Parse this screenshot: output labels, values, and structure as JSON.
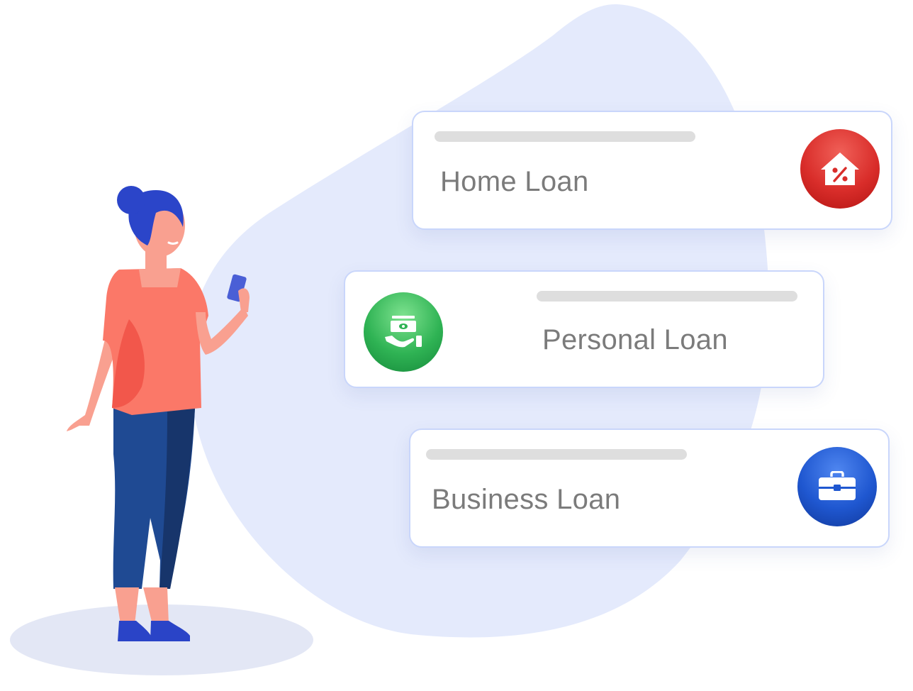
{
  "loans": [
    {
      "label": "Home Loan",
      "icon": "home-percent-icon",
      "color": "#d92d2a"
    },
    {
      "label": "Personal Loan",
      "icon": "money-hand-icon",
      "color": "#1fa84a"
    },
    {
      "label": "Business Loan",
      "icon": "briefcase-icon",
      "color": "#1a4fc2"
    }
  ],
  "colors": {
    "blob": "#e4eafc",
    "card_border": "#c9d6fb",
    "placeholder_bar": "#dedede",
    "label_text": "#7b7b7b"
  }
}
